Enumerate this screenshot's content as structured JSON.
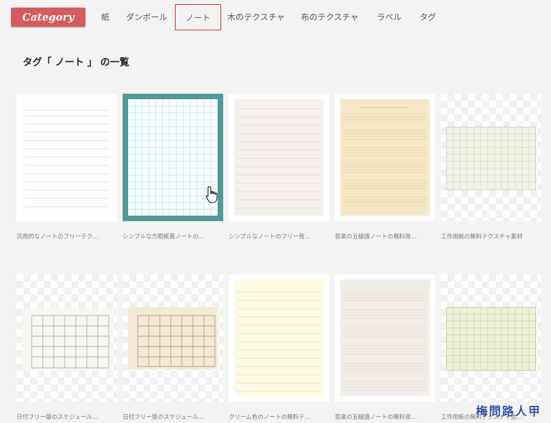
{
  "logo": "Category",
  "nav": [
    "紙",
    "ダンボール",
    "ノート",
    "木のテクスチャ",
    "布のテクスチャ",
    "ラベル",
    "タグ"
  ],
  "heading": "タグ「 ノート 」 の一覧",
  "items": [
    {
      "caption": "汎用的なノートのフリーテク..."
    },
    {
      "caption": "シンプルな方眼紙風ノートの..."
    },
    {
      "caption": "シンプルなノートのフリー背..."
    },
    {
      "caption": "音楽の五線譜ノートの無料背..."
    },
    {
      "caption": "工作用紙の無料テクスチャ素材"
    },
    {
      "caption": "日付フリー版のスケジュール..."
    },
    {
      "caption": "日付フリー版のスケジュール..."
    },
    {
      "caption": "クリーム色のノートの無料テ..."
    },
    {
      "caption": "音楽の五線譜ノートの無料背..."
    },
    {
      "caption": "工作用紙の無料テクスチャ素..."
    }
  ],
  "watermark": "梅問路人甲",
  "colors": {
    "accent": "#d45c5c",
    "active_border": "#d8262b",
    "selected": "#4f9a98"
  }
}
